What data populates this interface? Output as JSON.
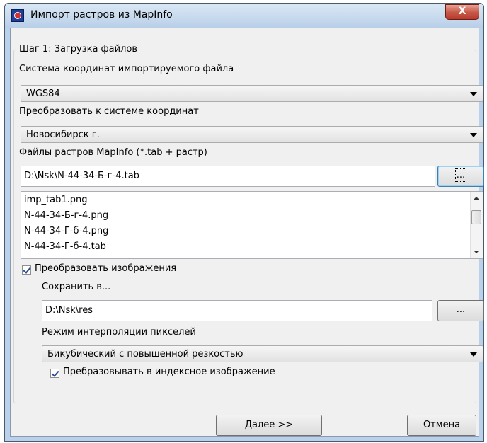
{
  "window": {
    "title": "Импорт растров из MapInfo",
    "close_glyph": "X",
    "icon": "app-icon"
  },
  "group": {
    "title": "Шаг 1: Загрузка файлов"
  },
  "source_cs": {
    "label": "Система координат импортируемого файла",
    "value": "WGS84"
  },
  "target_cs": {
    "label": "Преобразовать к системе координат",
    "value": "Новосибирск г."
  },
  "files": {
    "label": "Файлы растров MapInfo (*.tab + растр)",
    "path": "D:\\Nsk\\N-44-34-Б-г-4.tab",
    "browse_label": "...",
    "items": [
      "imp_tab1.png",
      "N-44-34-Б-г-4.png",
      "N-44-34-Г-б-4.png",
      "N-44-34-Г-б-4.tab"
    ]
  },
  "convert": {
    "checkbox_label": "Преобразовать изображения",
    "checked": true,
    "save_label": "Сохранить в...",
    "save_path": "D:\\Nsk\\res",
    "browse_label": "...",
    "interp_label": "Режим интерполяции пикселей",
    "interp_value": "Бикубический с повышенной резкостью",
    "indexed_label": "Пребразовывать в индексное изображение",
    "indexed_checked": true
  },
  "buttons": {
    "next": "Далее >>",
    "cancel": "Отмена"
  }
}
